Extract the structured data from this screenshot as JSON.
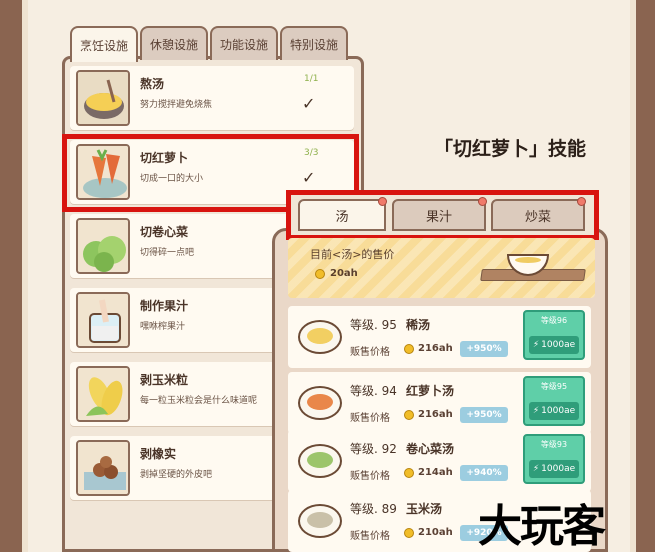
{
  "left_tabs": [
    {
      "label": "烹饪设施",
      "active": true
    },
    {
      "label": "休憩设施",
      "active": false
    },
    {
      "label": "功能设施",
      "active": false
    },
    {
      "label": "特别设施",
      "active": false
    }
  ],
  "skills": [
    {
      "title": "熬汤",
      "desc": "努力搅拌避免烧焦",
      "count": "1/1",
      "check": "✓",
      "icon": "soup-pot-icon"
    },
    {
      "title": "切红萝卜",
      "desc": "切成一口的大小",
      "count": "3/3",
      "check": "✓",
      "icon": "carrot-icon"
    },
    {
      "title": "切卷心菜",
      "desc": "切得碎一点吧",
      "count": "",
      "check": "",
      "icon": "cabbage-icon"
    },
    {
      "title": "制作果汁",
      "desc": "嘿咻榨果汁",
      "count": "",
      "check": "",
      "icon": "juice-icon"
    },
    {
      "title": "剥玉米粒",
      "desc": "每一粒玉米粒会是什么味道呢",
      "count": "",
      "check": "",
      "icon": "corn-icon"
    },
    {
      "title": "剥橡实",
      "desc": "剥掉坚硬的外皮吧",
      "count": "",
      "check": "",
      "icon": "acorn-icon"
    }
  ],
  "skill_heading": "「切红萝卜」技能",
  "right_tabs": [
    {
      "label": "汤",
      "active": true
    },
    {
      "label": "果汁",
      "active": false
    },
    {
      "label": "炒菜",
      "active": false
    }
  ],
  "current_price": {
    "label": "目前<汤>的售价",
    "value": "20ah"
  },
  "dishes": [
    {
      "level": "等级. 95",
      "name": "稀汤",
      "price_key": "贩售价格",
      "price": "216ah",
      "bonus": "+950%",
      "upgrade_label": "等级96",
      "upgrade_cost": "1000ae",
      "food_color": "#f2cf62"
    },
    {
      "level": "等级. 94",
      "name": "红萝卜汤",
      "price_key": "贩售价格",
      "price": "216ah",
      "bonus": "+950%",
      "upgrade_label": "等级95",
      "upgrade_cost": "1000ae",
      "food_color": "#e9874a"
    },
    {
      "level": "等级. 92",
      "name": "卷心菜汤",
      "price_key": "贩售价格",
      "price": "214ah",
      "bonus": "+940%",
      "upgrade_label": "等级93",
      "upgrade_cost": "1000ae",
      "food_color": "#9cc56b"
    },
    {
      "level": "等级. 89",
      "name": "玉米汤",
      "price_key": "贩售价格",
      "price": "210ah",
      "bonus": "+920%",
      "upgrade_label": "",
      "upgrade_cost": "",
      "food_color": "#c9c0a8"
    }
  ],
  "watermark": "大玩客"
}
